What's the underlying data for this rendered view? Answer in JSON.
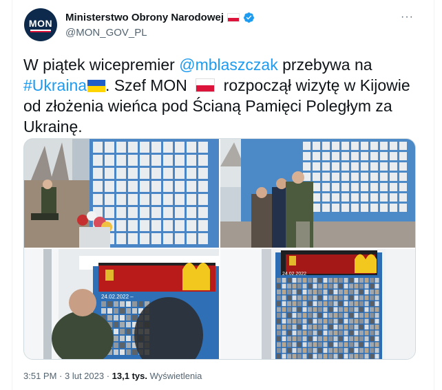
{
  "account": {
    "display_name": "Ministerstwo Obrony Narodowej",
    "handle": "@MON_GOV_PL",
    "avatar_text": "MON",
    "verified_icon": "verified-badge-icon",
    "flag_icon": "poland-flag-icon",
    "accent": "#1d9bf0"
  },
  "more_label": "···",
  "tweet": {
    "t1": "W piątek wicepremier ",
    "mention": "@mblaszczak",
    "t2": " przebywa na",
    "hashtag": "#Ukraina",
    "t3": ". Szef MON ",
    "t4": " rozpoczął wizytę w Kijowie",
    "t5": "od złożenia wieńca pod Ścianą Pamięci Poległym za",
    "t6": "Ukrainę."
  },
  "media": {
    "photo_count": 4,
    "sign_date_1": "24.02.2022 –",
    "sign_date_2": "24.02.2022"
  },
  "meta": {
    "time": "3:51 PM",
    "sep1": " · ",
    "date": "3 lut 2023",
    "sep2": " · ",
    "views_count": "13,1 tys.",
    "views_label": " Wyświetlenia"
  }
}
